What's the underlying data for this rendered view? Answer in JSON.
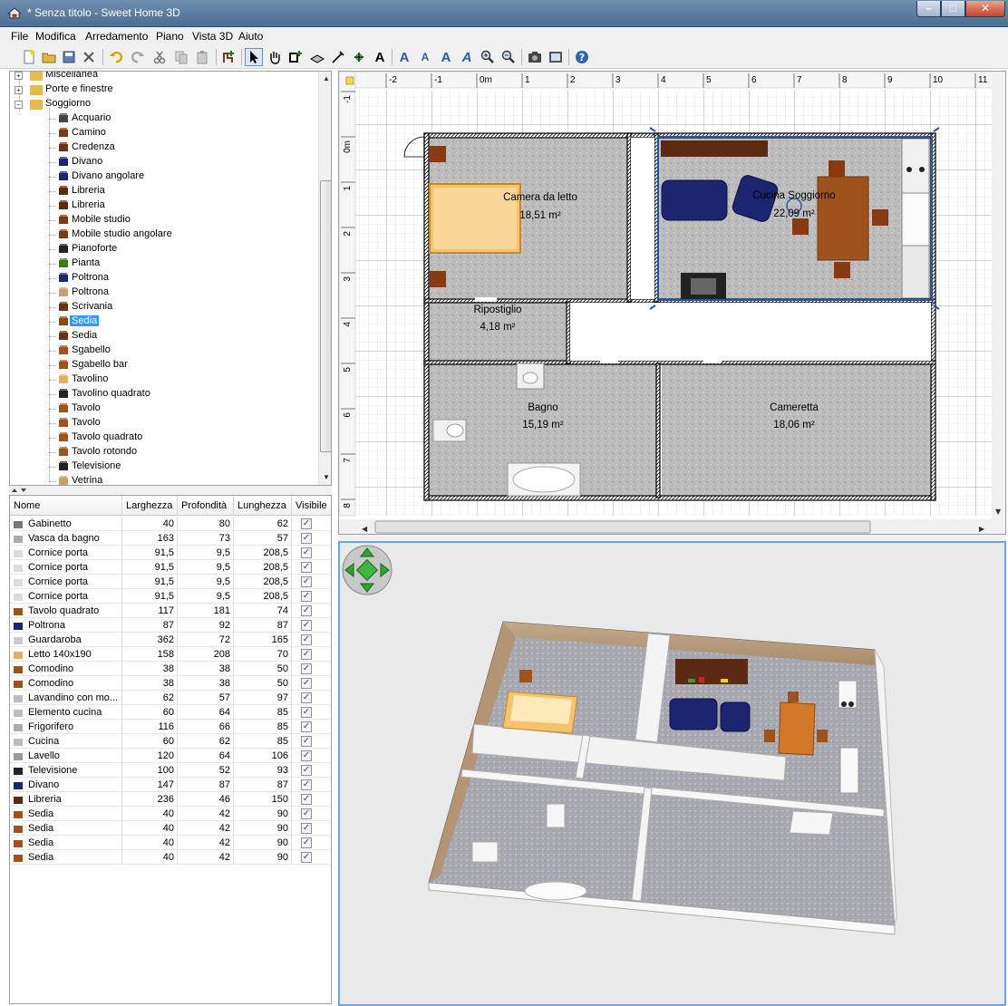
{
  "window": {
    "title": "* Senza titolo - Sweet Home 3D",
    "min_glyph": "–",
    "max_glyph": "□",
    "close_glyph": "✕"
  },
  "menu": [
    "File",
    "Modifica",
    "Arredamento",
    "Piano",
    "Vista 3D",
    "Aiuto"
  ],
  "toolbar": {
    "buttons": [
      "new-icon",
      "open-icon",
      "save-icon",
      "cut-tools-icon",
      "undo-icon",
      "redo-icon",
      "cut-icon",
      "copy-icon",
      "paste-icon",
      "add-furniture-icon",
      "select-icon",
      "pan-icon",
      "create-walls-icon",
      "create-rooms-icon",
      "create-dimensions-icon",
      "create-labels-icon",
      "add-text-icon",
      "increase-text-icon",
      "decrease-text-icon",
      "bold-text-icon",
      "italic-text-icon",
      "zoom-in-icon",
      "zoom-out-icon",
      "photo-icon",
      "video-icon",
      "help-icon"
    ]
  },
  "tree": {
    "items": [
      {
        "label": "Miscellanea",
        "type": "category"
      },
      {
        "label": "Porte e finestre",
        "type": "category"
      },
      {
        "label": "Soggiorno",
        "type": "category",
        "expanded": true
      },
      {
        "label": "Acquario",
        "type": "item"
      },
      {
        "label": "Camino",
        "type": "item"
      },
      {
        "label": "Credenza",
        "type": "item"
      },
      {
        "label": "Divano",
        "type": "item"
      },
      {
        "label": "Divano angolare",
        "type": "item"
      },
      {
        "label": "Libreria",
        "type": "item"
      },
      {
        "label": "Libreria",
        "type": "item"
      },
      {
        "label": "Mobile studio",
        "type": "item"
      },
      {
        "label": "Mobile studio angolare",
        "type": "item"
      },
      {
        "label": "Pianoforte",
        "type": "item"
      },
      {
        "label": "Pianta",
        "type": "item"
      },
      {
        "label": "Poltrona",
        "type": "item"
      },
      {
        "label": "Poltrona",
        "type": "item"
      },
      {
        "label": "Scrivania",
        "type": "item"
      },
      {
        "label": "Sedia",
        "type": "item",
        "selected": true
      },
      {
        "label": "Sedia",
        "type": "item"
      },
      {
        "label": "Sgabello",
        "type": "item"
      },
      {
        "label": "Sgabello bar",
        "type": "item"
      },
      {
        "label": "Tavolino",
        "type": "item"
      },
      {
        "label": "Tavolino quadrato",
        "type": "item"
      },
      {
        "label": "Tavolo",
        "type": "item"
      },
      {
        "label": "Tavolo",
        "type": "item"
      },
      {
        "label": "Tavolo quadrato",
        "type": "item"
      },
      {
        "label": "Tavolo rotondo",
        "type": "item"
      },
      {
        "label": "Televisione",
        "type": "item"
      },
      {
        "label": "Vetrina",
        "type": "item"
      }
    ]
  },
  "furniture_table": {
    "columns": [
      "Nome",
      "Larghezza",
      "Profondità",
      "Lunghezza",
      "Visibile"
    ],
    "rows": [
      {
        "name": "Gabinetto",
        "w": "40",
        "d": "80",
        "h": "62",
        "visible": true
      },
      {
        "name": "Vasca da bagno",
        "w": "163",
        "d": "73",
        "h": "57",
        "visible": true
      },
      {
        "name": "Cornice porta",
        "w": "91,5",
        "d": "9,5",
        "h": "208,5",
        "visible": true
      },
      {
        "name": "Cornice porta",
        "w": "91,5",
        "d": "9,5",
        "h": "208,5",
        "visible": true
      },
      {
        "name": "Cornice porta",
        "w": "91,5",
        "d": "9,5",
        "h": "208,5",
        "visible": true
      },
      {
        "name": "Cornice porta",
        "w": "91,5",
        "d": "9,5",
        "h": "208,5",
        "visible": true
      },
      {
        "name": "Tavolo quadrato",
        "w": "117",
        "d": "181",
        "h": "74",
        "visible": true
      },
      {
        "name": "Poltrona",
        "w": "87",
        "d": "92",
        "h": "87",
        "visible": true
      },
      {
        "name": "Guardaroba",
        "w": "362",
        "d": "72",
        "h": "165",
        "visible": true
      },
      {
        "name": "Letto 140x190",
        "w": "158",
        "d": "208",
        "h": "70",
        "visible": true
      },
      {
        "name": "Comodino",
        "w": "38",
        "d": "38",
        "h": "50",
        "visible": true
      },
      {
        "name": "Comodino",
        "w": "38",
        "d": "38",
        "h": "50",
        "visible": true
      },
      {
        "name": "Lavandino con mo...",
        "w": "62",
        "d": "57",
        "h": "97",
        "visible": true
      },
      {
        "name": "Elemento cucina",
        "w": "60",
        "d": "64",
        "h": "85",
        "visible": true
      },
      {
        "name": "Frigorifero",
        "w": "116",
        "d": "66",
        "h": "85",
        "visible": true
      },
      {
        "name": "Cucina",
        "w": "60",
        "d": "62",
        "h": "85",
        "visible": true
      },
      {
        "name": "Lavello",
        "w": "120",
        "d": "64",
        "h": "106",
        "visible": true
      },
      {
        "name": "Televisione",
        "w": "100",
        "d": "52",
        "h": "93",
        "visible": true
      },
      {
        "name": "Divano",
        "w": "147",
        "d": "87",
        "h": "87",
        "visible": true
      },
      {
        "name": "Libreria",
        "w": "236",
        "d": "46",
        "h": "150",
        "visible": true
      },
      {
        "name": "Sedia",
        "w": "40",
        "d": "42",
        "h": "90",
        "visible": true
      },
      {
        "name": "Sedia",
        "w": "40",
        "d": "42",
        "h": "90",
        "visible": true
      },
      {
        "name": "Sedia",
        "w": "40",
        "d": "42",
        "h": "90",
        "visible": true
      },
      {
        "name": "Sedia",
        "w": "40",
        "d": "42",
        "h": "90",
        "visible": true
      }
    ]
  },
  "plan": {
    "ruler_x": [
      "-2",
      "-1",
      "0m",
      "1",
      "2",
      "3",
      "4",
      "5",
      "6",
      "7",
      "8",
      "9",
      "10",
      "11"
    ],
    "ruler_y": [
      "-1",
      "0m",
      "1",
      "2",
      "3",
      "4",
      "5",
      "6",
      "7",
      "8"
    ],
    "rooms": [
      {
        "name": "Camera da letto",
        "area": "18,51 m²"
      },
      {
        "name": "Cucina Soggiorno",
        "area": "22,09 m²"
      },
      {
        "name": "Ripostiglio",
        "area": "4,18 m²"
      },
      {
        "name": "Bagno",
        "area": "15,19 m²"
      },
      {
        "name": "Cameretta",
        "area": "18,06 m²"
      }
    ]
  },
  "colors": {
    "accent": "#3399ff",
    "floor": "#b8b8b8",
    "wood": "#a0521c",
    "sofa": "#1b2570",
    "selection": "#2457a8",
    "bed": "#f5c36b"
  }
}
